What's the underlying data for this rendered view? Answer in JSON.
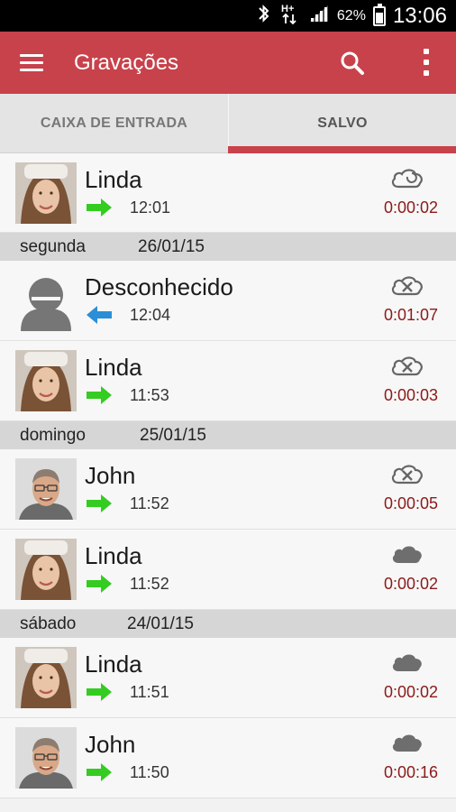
{
  "status_bar": {
    "battery_percent": "62%",
    "time": "13:06",
    "network": "H+"
  },
  "app_bar": {
    "title": "Gravações"
  },
  "tabs": [
    {
      "label": "CAIXA DE ENTRADA",
      "selected": false
    },
    {
      "label": "SALVO",
      "selected": true
    }
  ],
  "colors": {
    "accent": "#c8424b",
    "outgoing_arrow": "#34cc21",
    "incoming_arrow": "#2a8fd6",
    "duration": "#8b1a1a"
  },
  "list": {
    "first_record": {
      "name": "Linda",
      "avatar": "linda-photo",
      "direction": "outgoing",
      "time": "12:01",
      "cloud": "cloud-sync-icon",
      "duration": "0:00:02"
    },
    "groups": [
      {
        "day": "segunda",
        "date": "26/01/15",
        "records": [
          {
            "name": "Desconhecido",
            "avatar": "unknown-person-icon",
            "direction": "incoming",
            "time": "12:04",
            "cloud": "cloud-off-icon",
            "duration": "0:01:07"
          },
          {
            "name": "Linda",
            "avatar": "linda-photo",
            "direction": "outgoing",
            "time": "11:53",
            "cloud": "cloud-off-icon",
            "duration": "0:00:03"
          }
        ]
      },
      {
        "day": "domingo",
        "date": "25/01/15",
        "records": [
          {
            "name": "John",
            "avatar": "john-photo",
            "direction": "outgoing",
            "time": "11:52",
            "cloud": "cloud-off-icon",
            "duration": "0:00:05"
          },
          {
            "name": "Linda",
            "avatar": "linda-photo",
            "direction": "outgoing",
            "time": "11:52",
            "cloud": "cloud-filled-icon",
            "duration": "0:00:02"
          }
        ]
      },
      {
        "day": "sábado",
        "date": "24/01/15",
        "records": [
          {
            "name": "Linda",
            "avatar": "linda-photo",
            "direction": "outgoing",
            "time": "11:51",
            "cloud": "cloud-filled-icon",
            "duration": "0:00:02"
          },
          {
            "name": "John",
            "avatar": "john-photo",
            "direction": "outgoing",
            "time": "11:50",
            "cloud": "cloud-filled-icon",
            "duration": "0:00:16"
          }
        ]
      }
    ]
  }
}
